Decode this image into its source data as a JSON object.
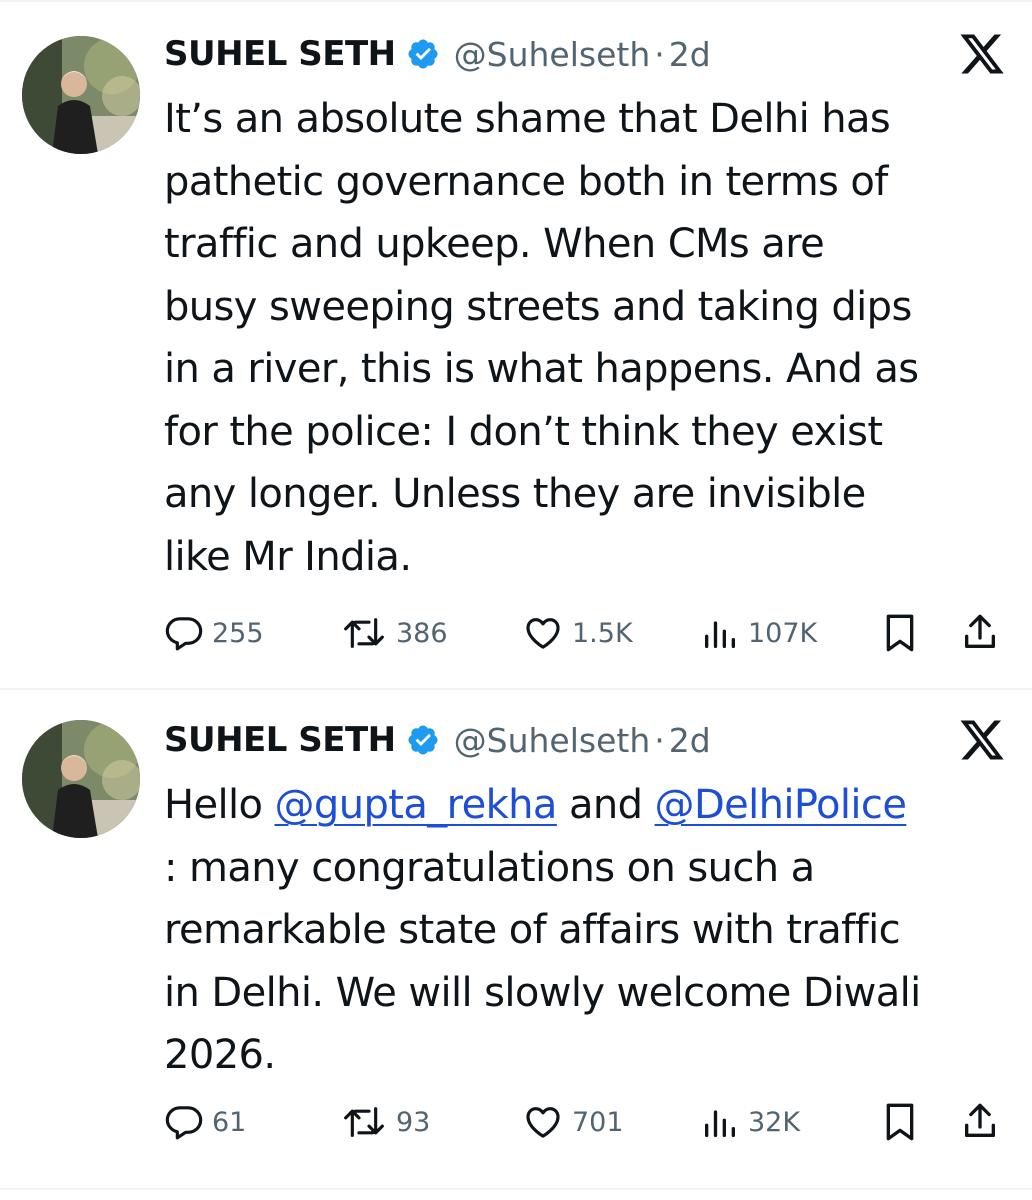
{
  "tweets": [
    {
      "author_name": "SUHEL SETH",
      "handle": "@Suhelseth",
      "separator": "·",
      "time": "2d",
      "lines": [
        [
          {
            "t": "It’s an absolute shame that Delhi has"
          }
        ],
        [
          {
            "t": "pathetic governance both in terms of"
          }
        ],
        [
          {
            "t": "traffic and upkeep. When CMs are"
          }
        ],
        [
          {
            "t": "busy sweeping streets and taking dips"
          }
        ],
        [
          {
            "t": "in a river, this is what happens. And as"
          }
        ],
        [
          {
            "t": "for the police: I don’t think they exist"
          }
        ],
        [
          {
            "t": "any longer. Unless they are invisible"
          }
        ],
        [
          {
            "t": "like Mr India."
          }
        ]
      ],
      "replies": "255",
      "reposts": "386",
      "likes": "1.5K",
      "views": "107K"
    },
    {
      "author_name": "SUHEL SETH",
      "handle": "@Suhelseth",
      "separator": "·",
      "time": "2d",
      "lines": [
        [
          {
            "t": "Hello "
          },
          {
            "t": "@gupta_rekha",
            "mention": true
          },
          {
            "t": " and "
          },
          {
            "t": "@DelhiPolice",
            "mention": true
          }
        ],
        [
          {
            "t": ": many congratulations on such a"
          }
        ],
        [
          {
            "t": "remarkable state of affairs with traffic"
          }
        ],
        [
          {
            "t": "in Delhi. We will slowly welcome Diwali"
          }
        ],
        [
          {
            "t": "2026."
          }
        ]
      ],
      "replies": "61",
      "reposts": "93",
      "likes": "701",
      "views": "32K"
    }
  ],
  "icons": {
    "verified": "verified-badge-icon",
    "platform": "x-logo-icon",
    "reply": "reply-icon",
    "repost": "repost-icon",
    "like": "heart-icon",
    "views": "views-icon",
    "bookmark": "bookmark-icon",
    "share": "share-icon"
  },
  "colors": {
    "text": "#0f1419",
    "secondary": "#536471",
    "verified": "#1d9bf0",
    "mention": "#1d4ed8",
    "divider": "#eff3f4"
  }
}
